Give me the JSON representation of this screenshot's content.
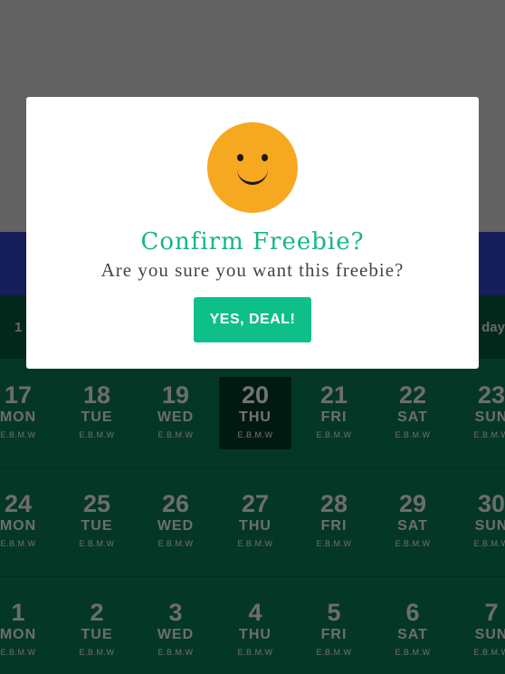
{
  "header_strip": {
    "left_text": "1",
    "right_text": "day"
  },
  "calendar": {
    "weeks": [
      [
        {
          "num": "17",
          "day": "MON",
          "sub": "E.B.M.W"
        },
        {
          "num": "18",
          "day": "TUE",
          "sub": "E.B.M.W"
        },
        {
          "num": "19",
          "day": "WED",
          "sub": "E.B.M.W"
        },
        {
          "num": "20",
          "day": "THU",
          "sub": "E.B.M.W",
          "selected": true
        },
        {
          "num": "21",
          "day": "FRI",
          "sub": "E.B.M.W"
        },
        {
          "num": "22",
          "day": "SAT",
          "sub": "E.B.M.W"
        },
        {
          "num": "23",
          "day": "SUN",
          "sub": "E.B.M.W"
        }
      ],
      [
        {
          "num": "24",
          "day": "MON",
          "sub": "E.B.M.W"
        },
        {
          "num": "25",
          "day": "TUE",
          "sub": "E.B.M.W"
        },
        {
          "num": "26",
          "day": "WED",
          "sub": "E.B.M.W"
        },
        {
          "num": "27",
          "day": "THU",
          "sub": "E.B.M.W"
        },
        {
          "num": "28",
          "day": "FRI",
          "sub": "E.B.M.W"
        },
        {
          "num": "29",
          "day": "SAT",
          "sub": "E.B.M.W"
        },
        {
          "num": "30",
          "day": "SUN",
          "sub": "E.B.M.W"
        }
      ],
      [
        {
          "num": "1",
          "day": "MON",
          "sub": "E.B.M.W"
        },
        {
          "num": "2",
          "day": "TUE",
          "sub": "E.B.M.W"
        },
        {
          "num": "3",
          "day": "WED",
          "sub": "E.B.M.W"
        },
        {
          "num": "4",
          "day": "THU",
          "sub": "E.B.M.W"
        },
        {
          "num": "5",
          "day": "FRI",
          "sub": "E.B.M.W"
        },
        {
          "num": "6",
          "day": "SAT",
          "sub": "E.B.M.W"
        },
        {
          "num": "7",
          "day": "SUN",
          "sub": "E.B.M.W"
        }
      ]
    ]
  },
  "modal": {
    "icon": "smiley-face-icon",
    "title": "Confirm Freebie?",
    "message": "Are you sure you want this freebie?",
    "confirm_label": "YES, DEAL!"
  },
  "colors": {
    "accent": "#0fbf8a",
    "title": "#18b58a",
    "smiley": "#f6a821",
    "calendar_bg": "#0c7a55",
    "selected_day": "#023b27",
    "blue_bar": "#2f44c8"
  }
}
